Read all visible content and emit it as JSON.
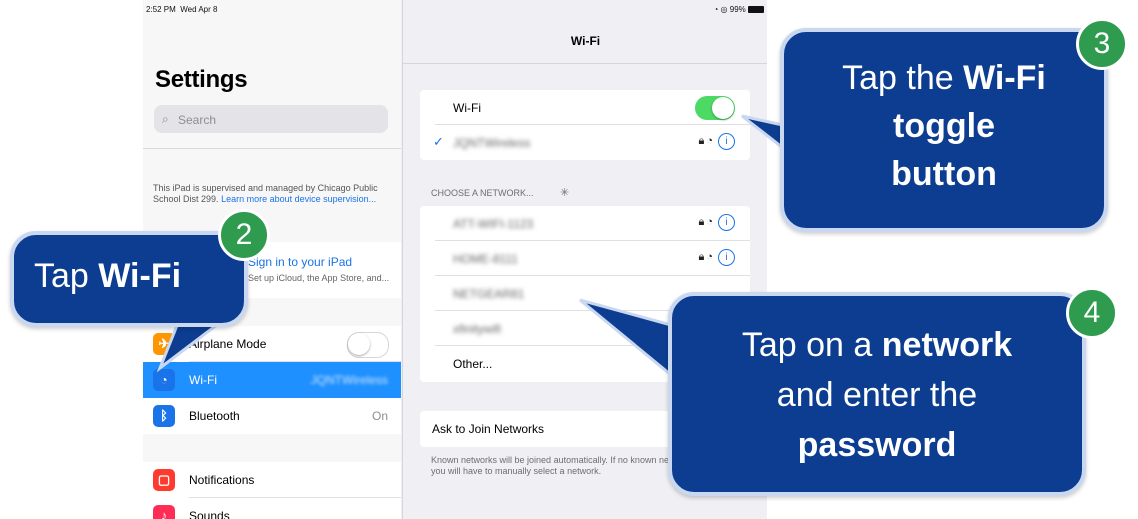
{
  "status": {
    "time": "2:52 PM",
    "date": "Wed Apr 8",
    "battery": "99%"
  },
  "settings": {
    "title": "Settings",
    "search_placeholder": "Search",
    "supervised_text": "This iPad is supervised and managed by Chicago Public School Dist 299.",
    "learn_more": "Learn more about device supervision...",
    "account_title": "Sign in to your iPad",
    "account_sub": "Set up iCloud, the App Store, and...",
    "items": [
      {
        "label": "Airplane Mode",
        "value": ""
      },
      {
        "label": "Wi-Fi",
        "value": "JQNTWireless"
      },
      {
        "label": "Bluetooth",
        "value": "On"
      },
      {
        "label": "Notifications",
        "value": ""
      },
      {
        "label": "Sounds",
        "value": ""
      }
    ]
  },
  "wifi": {
    "nav_title": "Wi-Fi",
    "toggle_label": "Wi-Fi",
    "toggle_on": true,
    "connected": "JQNTWireless",
    "choose_header": "CHOOSE A NETWORK...",
    "networks": [
      "ATT-WIFI-1123",
      "HOME-8111",
      "NETGEAR81",
      "xfinitywifi"
    ],
    "other": "Other...",
    "ask_label": "Ask to Join Networks",
    "ask_desc": "Known networks will be joined automatically. If no known networks are available, you will have to manually select a network."
  },
  "callouts": {
    "step2": {
      "num": "2",
      "pre": "Tap ",
      "bold": "Wi-Fi"
    },
    "step3": {
      "num": "3",
      "pre": "Tap the ",
      "bold1": "Wi-Fi",
      "bold2": "toggle",
      "bold3": "button"
    },
    "step4": {
      "num": "4",
      "pre": "Tap on a ",
      "bold1": "network",
      "mid": "and enter the",
      "bold2": "password"
    }
  },
  "colors": {
    "callout_bg": "#0c3d91",
    "badge": "#2e9b4f",
    "toggle_on": "#4cd964",
    "selected_row": "#1e90ff"
  }
}
